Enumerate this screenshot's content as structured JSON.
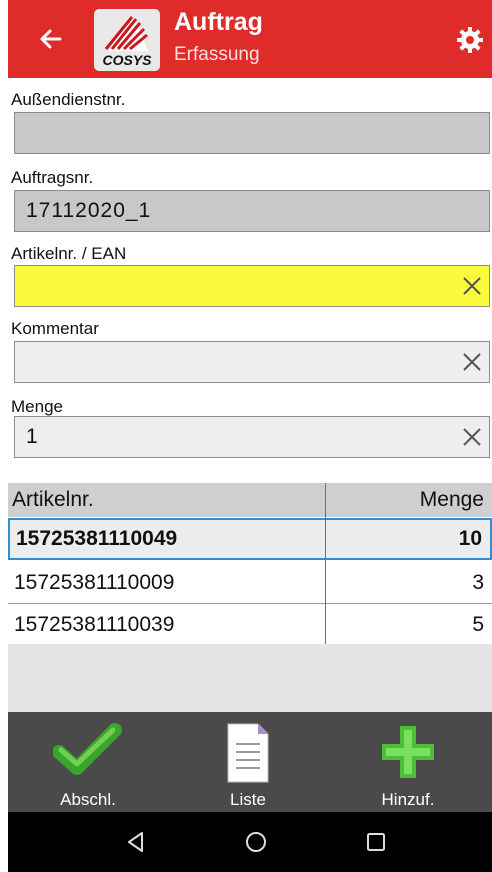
{
  "header": {
    "title": "Auftrag",
    "subtitle": "Erfassung",
    "logo_text": "COSYS",
    "colors": {
      "bar": "#e02b2b"
    }
  },
  "form": {
    "aussendienst_label": "Außendienstnr.",
    "aussendienst_value": "",
    "auftrag_label": "Auftragsnr.",
    "auftrag_value": "17112020_1",
    "artikel_label": "Artikelnr. / EAN",
    "artikel_value": "",
    "kommentar_label": "Kommentar",
    "kommentar_value": "",
    "menge_label": "Menge",
    "menge_value": "1"
  },
  "table": {
    "headers": [
      "Artikelnr.",
      "Menge"
    ],
    "rows": [
      {
        "artikel": "15725381110049",
        "menge": "10",
        "selected": true
      },
      {
        "artikel": "15725381110009",
        "menge": "3",
        "selected": false
      },
      {
        "artikel": "15725381110039",
        "menge": "5",
        "selected": false
      }
    ]
  },
  "bottom": {
    "actions": [
      {
        "label": "Abschl.",
        "icon": "checkmark-icon"
      },
      {
        "label": "Liste",
        "icon": "list-document-icon"
      },
      {
        "label": "Hinzuf.",
        "icon": "plus-icon"
      }
    ]
  },
  "nav": [
    "back-triangle-icon",
    "home-circle-icon",
    "recents-square-icon"
  ]
}
